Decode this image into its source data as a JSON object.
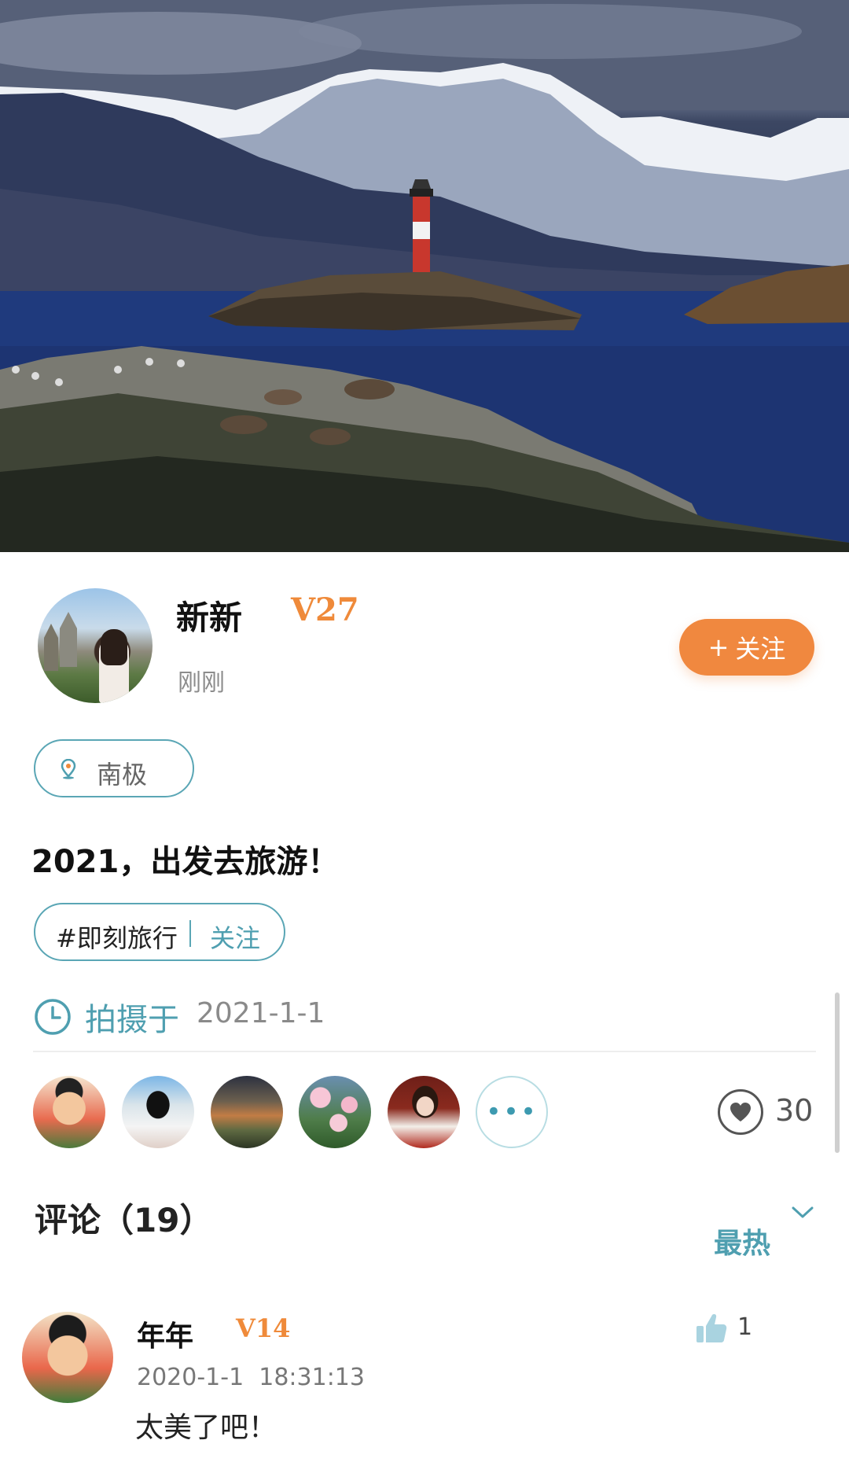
{
  "author": {
    "name": "新新",
    "level": "V27",
    "time": "刚刚",
    "follow_label": "关注",
    "follow_icon": "plus-icon"
  },
  "location": {
    "label": "南极",
    "icon": "map-pin-icon"
  },
  "post": {
    "title": "2021，出发去旅游！"
  },
  "topic": {
    "tag": "#即刻旅行",
    "follow_label": "关注"
  },
  "shot": {
    "label": "拍摄于",
    "date": "2021-1-1",
    "icon": "clock-icon"
  },
  "likes": {
    "more_label": "•••",
    "count": "30",
    "icon": "heart-icon"
  },
  "comments": {
    "title": "评论（19）",
    "sort_label": "最热",
    "items": [
      {
        "name": "年年",
        "level": "V14",
        "time": "2020-1-1  18:31:13",
        "text": "太美了吧！",
        "likes": "1"
      }
    ]
  },
  "colors": {
    "accent_orange": "#f0883f",
    "accent_teal": "#4f9fb0"
  }
}
